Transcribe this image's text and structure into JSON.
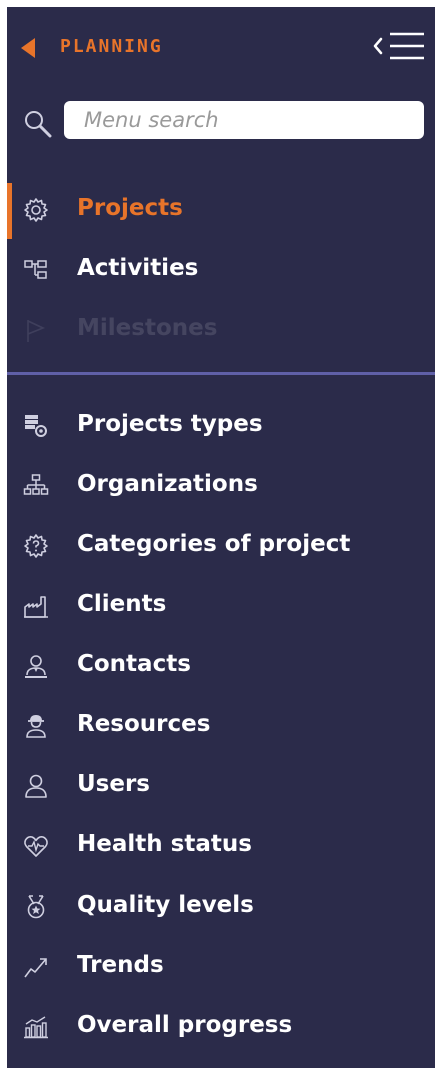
{
  "header": {
    "title": "PLANNING"
  },
  "search": {
    "placeholder": "Menu search"
  },
  "primary_items": [
    {
      "label": "Projects",
      "icon": "gear-icon",
      "active": true
    },
    {
      "label": "Activities",
      "icon": "hierarchy-icon",
      "active": false
    },
    {
      "label": "Milestones",
      "icon": "flag-icon",
      "active": false
    }
  ],
  "secondary_items": [
    {
      "label": "Projects types",
      "icon": "stack-gear-icon"
    },
    {
      "label": "Organizations",
      "icon": "org-chart-icon"
    },
    {
      "label": "Categories of project",
      "icon": "question-gear-icon"
    },
    {
      "label": "Clients",
      "icon": "factory-icon"
    },
    {
      "label": "Contacts",
      "icon": "contact-icon"
    },
    {
      "label": "Resources",
      "icon": "worker-icon"
    },
    {
      "label": "Users",
      "icon": "user-icon"
    },
    {
      "label": "Health status",
      "icon": "heart-pulse-icon"
    },
    {
      "label": "Quality levels",
      "icon": "medal-icon"
    },
    {
      "label": "Trends",
      "icon": "trend-icon"
    },
    {
      "label": "Overall progress",
      "icon": "bar-chart-icon"
    }
  ],
  "colors": {
    "background": "#2b2b4a",
    "accent": "#e8742a",
    "divider": "#6060a8",
    "text": "#ffffff"
  }
}
